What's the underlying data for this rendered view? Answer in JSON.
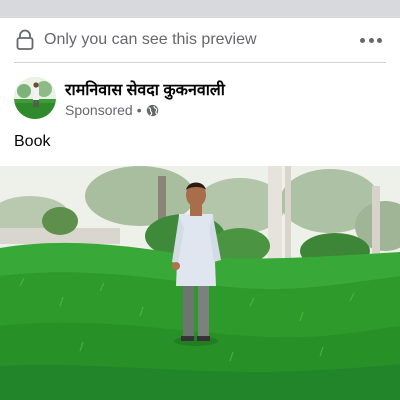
{
  "preview_bar": {
    "text": "Only you can see this preview",
    "lock_icon": "lock-icon",
    "more_icon": "more-options-icon"
  },
  "post": {
    "page_name": "रामनिवास सेवदा कुकनवाली",
    "meta": {
      "sponsored_label": "Sponsored",
      "separator": "•",
      "audience_icon": "globe-icon"
    },
    "text": "Book"
  },
  "colors": {
    "secondary_text": "#65676b",
    "primary_text": "#050505",
    "divider": "#ced0d4",
    "top_strip": "#d8d9dd"
  }
}
